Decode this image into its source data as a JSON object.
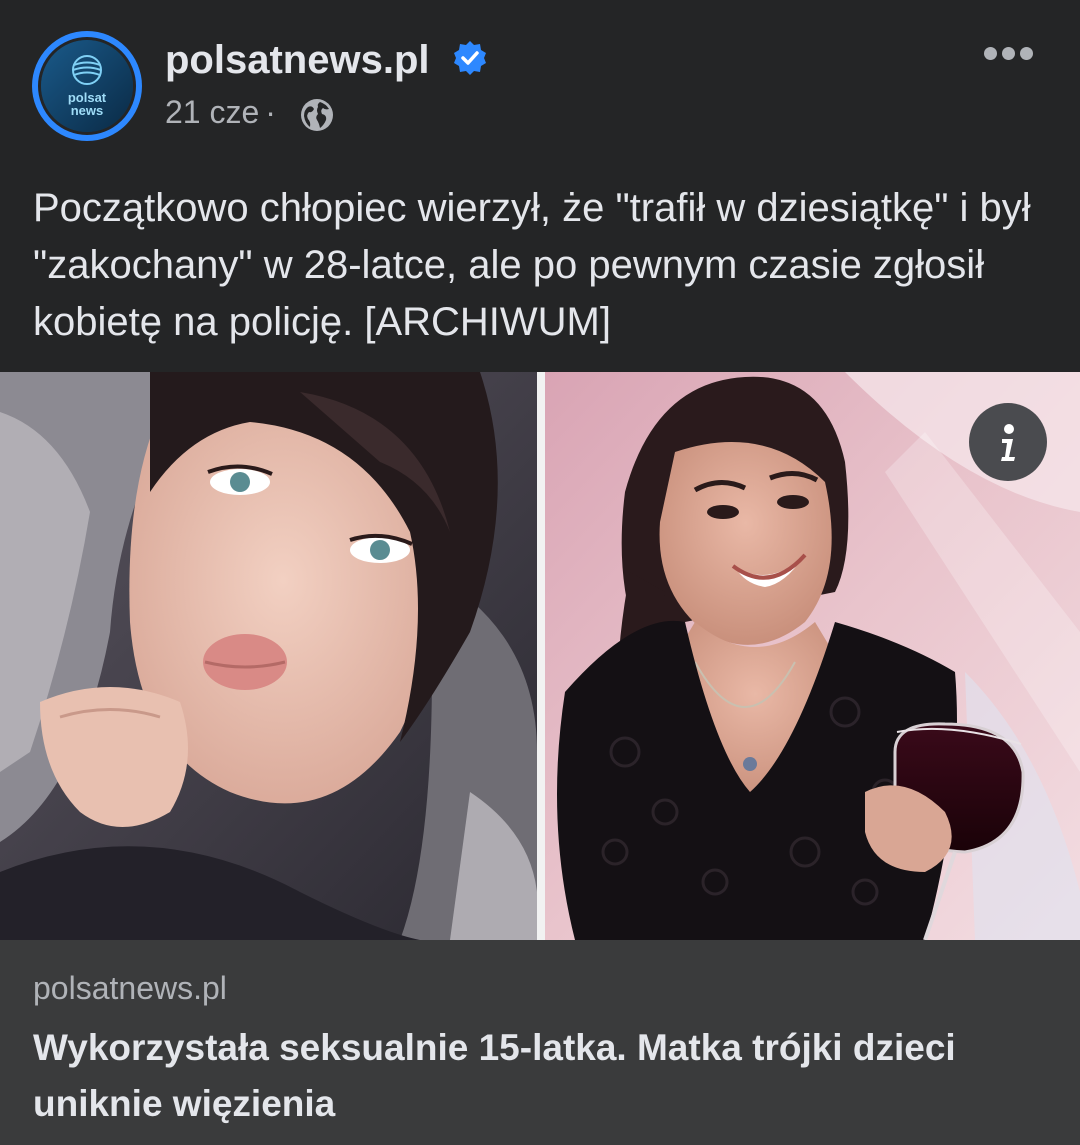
{
  "post": {
    "page_name": "polsatnews.pl",
    "verified": true,
    "date": "21 cze",
    "separator": "·",
    "audience_icon": "globe-icon",
    "avatar_text_line1": "polsat",
    "avatar_text_line2": "news",
    "caption": "Początkowo chłopiec wierzył, że \"trafił w dziesiątkę\" i był \"zakochany\" w 28-latce, ale po pewnym czasie zgłosił kobietę na policję. [ARCHIWUM]"
  },
  "link_preview": {
    "domain": "polsatnews.pl",
    "title": "Wykorzystała seksualnie 15-latka. Matka trójki dzieci uniknie więzienia"
  },
  "icons": {
    "more": "more-options-icon",
    "info": "info-icon",
    "verified": "verified-badge-icon"
  },
  "colors": {
    "background": "#242526",
    "card": "#3a3b3c",
    "text_primary": "#e4e6eb",
    "text_secondary": "#b0b3b8",
    "verified_blue": "#2d88ff"
  }
}
